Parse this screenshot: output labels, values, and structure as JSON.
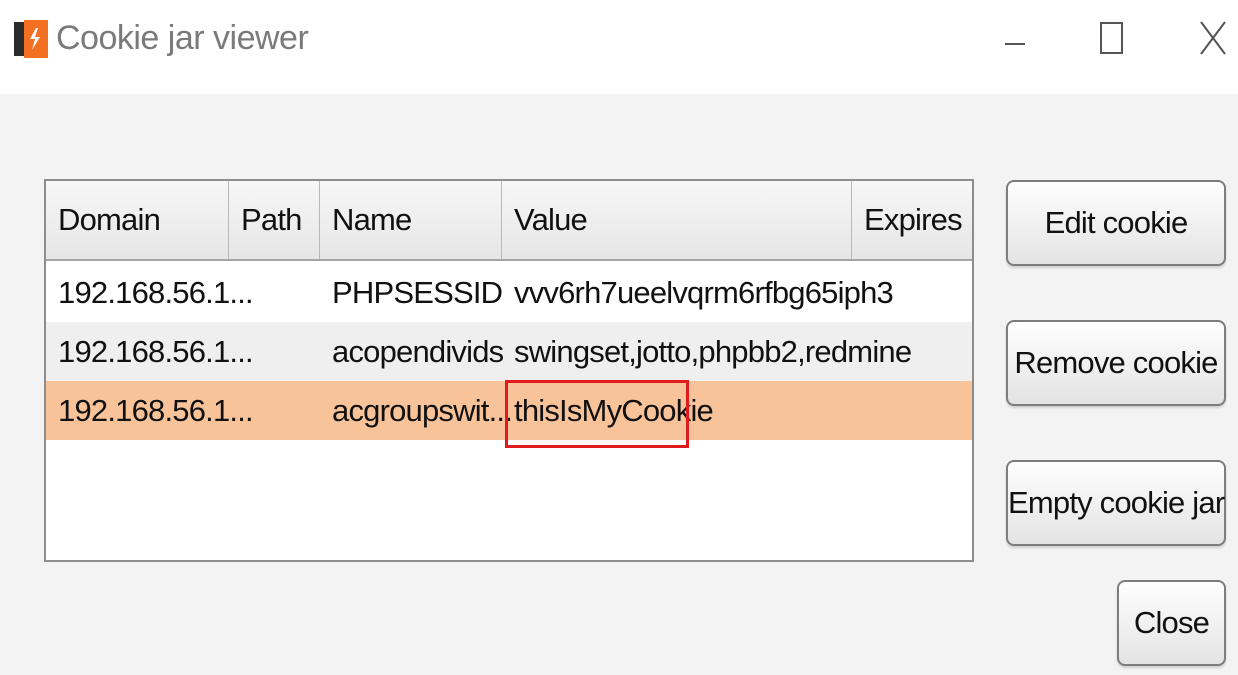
{
  "window": {
    "title": "Cookie jar viewer",
    "accent_color": "#f36f21"
  },
  "controls": {
    "minimize_icon": "minimize-icon",
    "maximize_icon": "maximize-icon",
    "close_icon": "close-icon"
  },
  "table": {
    "columns": [
      "Domain",
      "Path",
      "Name",
      "Value",
      "Expires"
    ],
    "rows": [
      {
        "domain": "192.168.56.1...",
        "path": "",
        "name": "PHPSESSID",
        "value": "vvv6rh7ueelvqrm6rfbg65iph3",
        "expires": ""
      },
      {
        "domain": "192.168.56.1...",
        "path": "",
        "name": "acopendivids",
        "value": "swingset,jotto,phpbb2,redmine",
        "expires": ""
      },
      {
        "domain": "192.168.56.1...",
        "path": "",
        "name": "acgroupswit...",
        "value": "thisIsMyCookie",
        "expires": ""
      }
    ],
    "selected_row": 2,
    "selection_color": "#f9c39a",
    "highlight_color": "#e01b1b"
  },
  "buttons": {
    "edit": "Edit cookie",
    "remove": "Remove cookie",
    "empty": "Empty cookie jar",
    "close": "Close"
  }
}
